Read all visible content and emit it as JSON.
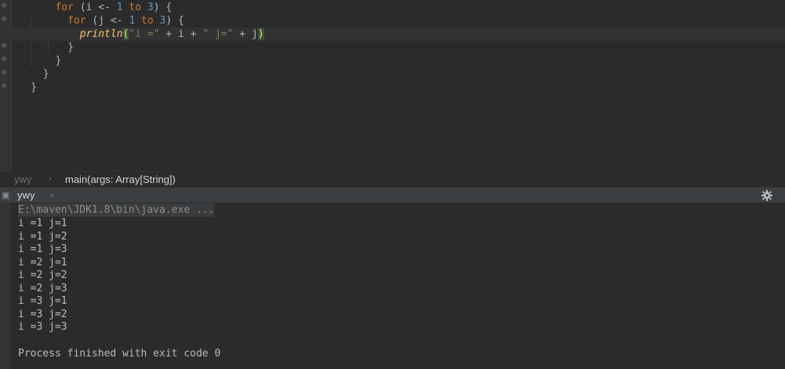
{
  "editor": {
    "lines": [
      {
        "indent": "    ",
        "tokens": [
          {
            "t": "for",
            "c": "kw"
          },
          {
            "t": " (i <- ",
            "c": ""
          },
          {
            "t": "1",
            "c": "num"
          },
          {
            "t": " to ",
            "c": "kw"
          },
          {
            "t": "3",
            "c": "num"
          },
          {
            "t": ") {",
            "c": ""
          }
        ]
      },
      {
        "indent": "      ",
        "tokens": [
          {
            "t": "for",
            "c": "kw"
          },
          {
            "t": " (j <- ",
            "c": ""
          },
          {
            "t": "1",
            "c": "num"
          },
          {
            "t": " to ",
            "c": "kw"
          },
          {
            "t": "3",
            "c": "num"
          },
          {
            "t": ") {",
            "c": ""
          }
        ]
      },
      {
        "indent": "        ",
        "current": true,
        "tokens": [
          {
            "t": "println",
            "c": "fn"
          },
          {
            "t": "(",
            "c": "bracket-hl"
          },
          {
            "t": "\"i =\"",
            "c": "str"
          },
          {
            "t": " + i + ",
            "c": ""
          },
          {
            "t": "\" j=\"",
            "c": "str"
          },
          {
            "t": " + j",
            "c": ""
          },
          {
            "t": ")",
            "c": "bracket-hl"
          }
        ]
      },
      {
        "indent": "      ",
        "tokens": [
          {
            "t": "}",
            "c": ""
          }
        ]
      },
      {
        "indent": "    ",
        "tokens": [
          {
            "t": "}",
            "c": ""
          }
        ]
      },
      {
        "indent": "  ",
        "tokens": [
          {
            "t": "}",
            "c": ""
          }
        ]
      },
      {
        "indent": "",
        "tokens": [
          {
            "t": "}",
            "c": ""
          }
        ]
      }
    ]
  },
  "breadcrumb": {
    "object": "ywy",
    "separator": "›",
    "method": "main(args: Array[String])"
  },
  "run_panel": {
    "tab_label": "ywy",
    "close_glyph": "×",
    "settings_icon": "gear-icon"
  },
  "console": {
    "command": "E:\\maven\\JDK1.8\\bin\\java.exe ...",
    "output": [
      "i =1 j=1",
      "i =1 j=2",
      "i =1 j=3",
      "i =2 j=1",
      "i =2 j=2",
      "i =2 j=3",
      "i =3 j=1",
      "i =3 j=2",
      "i =3 j=3"
    ],
    "exit_message": "Process finished with exit code 0"
  }
}
